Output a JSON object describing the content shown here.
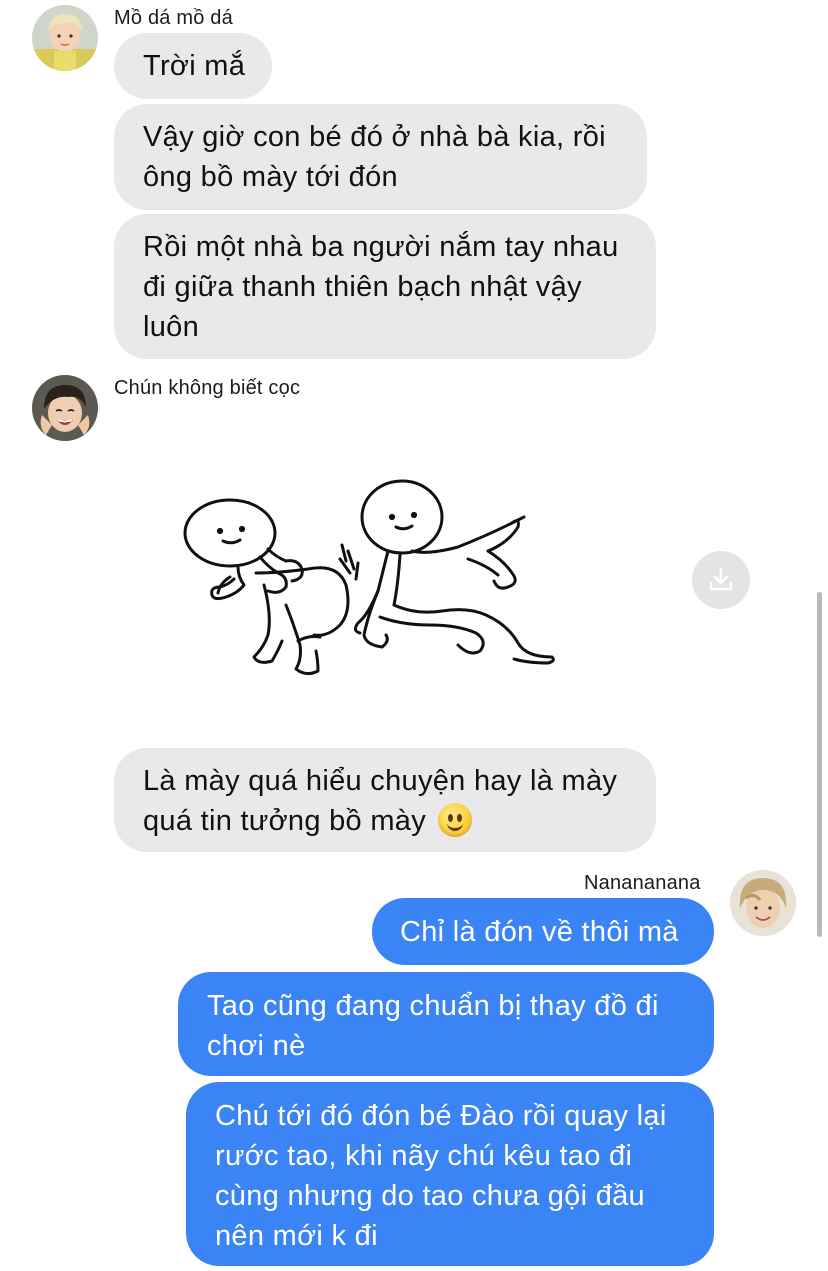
{
  "conversation": {
    "groups": [
      {
        "sender": "Mồ dá mồ dá",
        "avatar": "avatar-blond-boy",
        "messages": [
          {
            "lines": [
              "Trời mắ"
            ]
          },
          {
            "lines": [
              "Vậy giờ con bé đó ở nhà bà kia, rồi",
              "ông bồ mày tới đón"
            ]
          },
          {
            "lines": [
              "Rồi một nhà ba người nắm tay nhau",
              "đi giữa thanh thiên bạch nhật vậy",
              "luôn"
            ]
          }
        ]
      },
      {
        "sender": "Chún không biết cọc",
        "avatar": "avatar-laughing-boy",
        "sticker": "two-stick-figures-kick-sticker",
        "download_icon": "download-icon",
        "messages": [
          {
            "lines": [
              "Là mày quá hiểu chuyện hay là mày",
              "quá tin tưởng bồ mày"
            ],
            "emoji": "slightly-smiling-face-emoji"
          }
        ]
      },
      {
        "sender": "Nanananana",
        "avatar": "avatar-self",
        "outgoing": true,
        "messages": [
          {
            "lines": [
              "Chỉ là đón về thôi mà"
            ]
          },
          {
            "lines": [
              "Tao cũng đang chuẩn bị thay đồ đi",
              "chơi nè"
            ]
          },
          {
            "lines": [
              "Chú tới đó đón bé Đào rồi quay lại",
              "rước tao, khi nãy chú kêu tao đi",
              "cùng nhưng do tao chưa gội đầu",
              "nên mới k đi"
            ]
          }
        ]
      }
    ]
  },
  "colors": {
    "incoming_bubble": "#e9e9eb",
    "outgoing_bubble": "#3b84f6",
    "background": "#ffffff"
  }
}
